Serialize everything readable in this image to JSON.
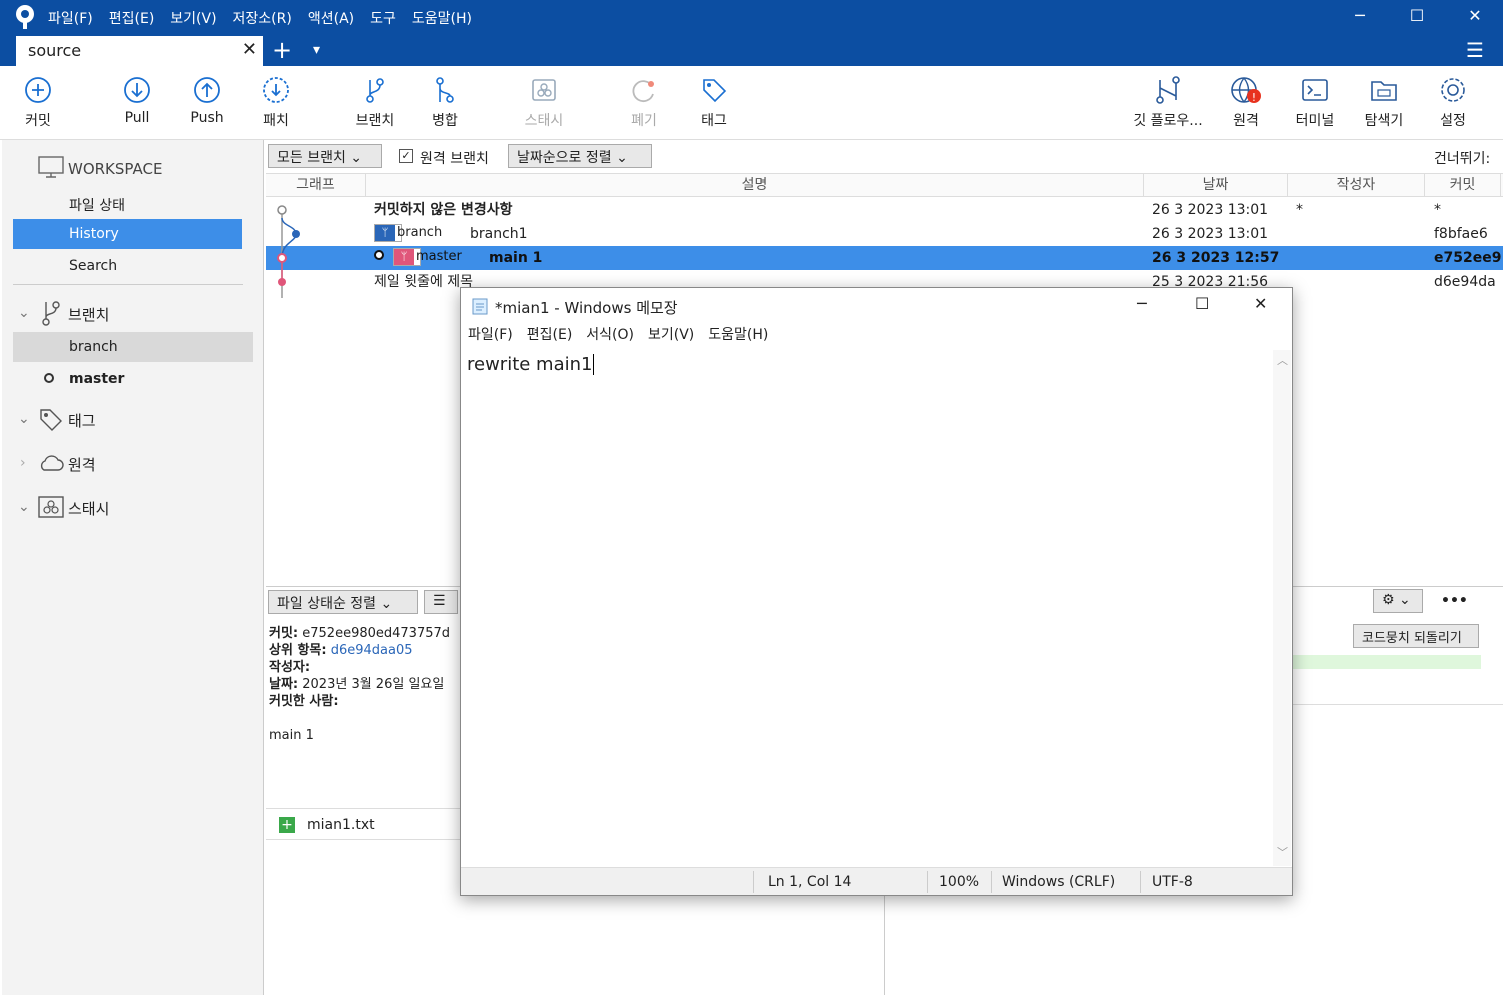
{
  "window": {
    "menus": [
      "파일(F)",
      "편집(E)",
      "보기(V)",
      "저장소(R)",
      "액션(A)",
      "도구",
      "도움말(H)"
    ],
    "minimize": "─",
    "maximize": "☐",
    "close": "✕"
  },
  "tab": {
    "title": "source",
    "close": "✕",
    "add": "+",
    "dropdown": "▾",
    "hamburger": "☰"
  },
  "toolbar": {
    "commit": "커밋",
    "pull": "Pull",
    "push": "Push",
    "fetch": "패치",
    "branch": "브랜치",
    "merge": "병합",
    "stash": "스태시",
    "discard": "폐기",
    "tag": "태그",
    "gitflow": "깃 플로우...",
    "remote": "원격",
    "terminal": "터미널",
    "explorer": "탐색기",
    "settings": "설정"
  },
  "sidebar": {
    "workspace": "WORKSPACE",
    "file_status": "파일 상태",
    "history": "History",
    "search": "Search",
    "branches": "브랜치",
    "branch_items": [
      "branch",
      "master"
    ],
    "tags": "태그",
    "remotes": "원격",
    "stashes": "스태시"
  },
  "filters": {
    "all_branches": "모든 브랜치",
    "remote_branches": "원격 브랜치",
    "sort_date": "날짜순으로 정렬",
    "skip": "건너뛰기:"
  },
  "columns": {
    "graph": "그래프",
    "description": "설명",
    "date": "날짜",
    "author": "작성자",
    "commit": "커밋"
  },
  "commits": [
    {
      "desc": "커밋하지 않은 변경사항",
      "date": "26 3 2023 13:01",
      "author": "*",
      "hash": "*"
    },
    {
      "badge": "branch",
      "desc": "branch1",
      "date": "26 3 2023 13:01",
      "author": "",
      "hash": "f8bfae6"
    },
    {
      "badge": "master",
      "desc": "main 1",
      "date": "26 3 2023 12:57",
      "author": "",
      "hash": "e752ee9"
    },
    {
      "desc": "제일 윗줄에 제목",
      "date": "25 3 2023 21:56",
      "author": "",
      "hash": "d6e94da"
    }
  ],
  "details": {
    "sort_label": "파일 상태순 정렬",
    "commit_label": "커밋:",
    "commit_value": "e752ee980ed473757d",
    "parent_label": "상위 항목:",
    "parent_value": "d6e94daa05",
    "author_label": "작성자:",
    "date_label": "날짜:",
    "date_value": "2023년 3월 26일 일요일",
    "committer_label": "커밋한 사람:",
    "message": "main 1",
    "file": "mian1.txt",
    "revert_hunk": "코드뭉치 되돌리기",
    "more": "•••"
  },
  "notepad": {
    "title": "*mian1 - Windows 메모장",
    "menus": [
      "파일(F)",
      "편집(E)",
      "서식(O)",
      "보기(V)",
      "도움말(H)"
    ],
    "text": "rewrite main1",
    "position": "Ln 1, Col 14",
    "zoom": "100%",
    "line_ending": "Windows (CRLF)",
    "encoding": "UTF-8"
  },
  "colors": {
    "titlebar": "#0c4ea2",
    "selection": "#3d8ee8",
    "master_badge": "#e0567a",
    "branch_badge": "#2a66b8"
  }
}
